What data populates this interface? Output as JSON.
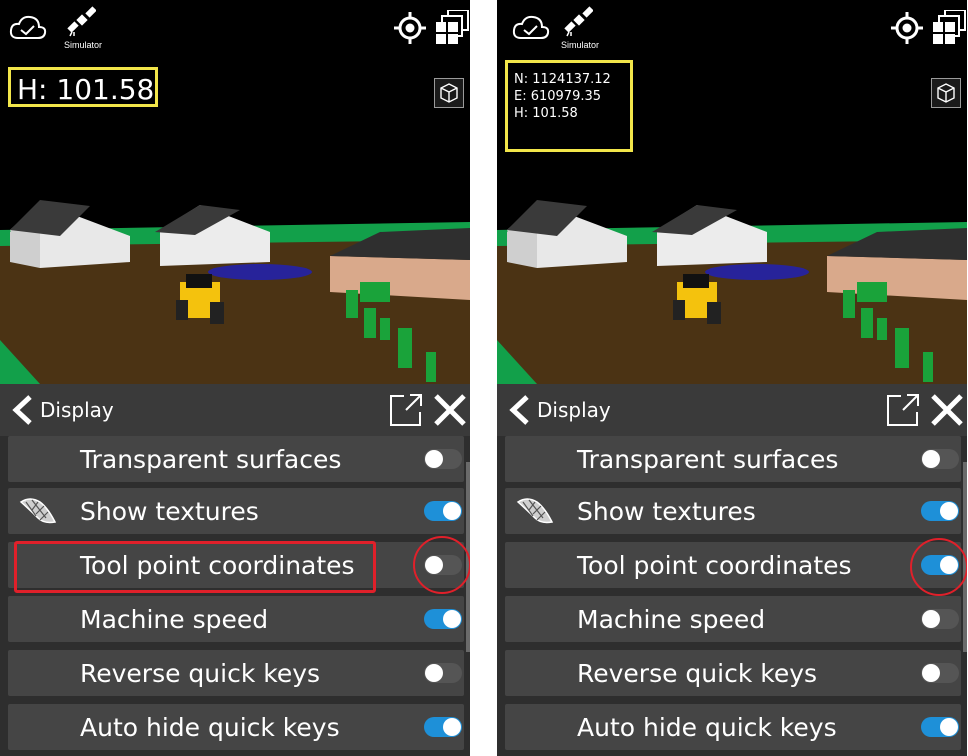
{
  "panels": [
    {
      "id": "before",
      "status": {
        "sim_label": "Simulator"
      },
      "hud": {
        "lines": [
          "H: 101.58"
        ]
      },
      "display": {
        "title": "Display",
        "items": [
          {
            "label": "Transparent surfaces",
            "on": false
          },
          {
            "label": "Show textures",
            "on": true,
            "has_icon": true
          },
          {
            "label": "Tool point coordinates",
            "on": false
          },
          {
            "label": "Machine speed",
            "on": true
          },
          {
            "label": "Reverse quick keys",
            "on": false
          },
          {
            "label": "Auto hide quick keys",
            "on": true
          }
        ]
      }
    },
    {
      "id": "after",
      "status": {
        "sim_label": "Simulator"
      },
      "hud": {
        "lines": [
          "N: 1124137.12",
          "E: 610979.35",
          "H: 101.58"
        ]
      },
      "display": {
        "title": "Display",
        "items": [
          {
            "label": "Transparent surfaces",
            "on": false
          },
          {
            "label": "Show textures",
            "on": true,
            "has_icon": true
          },
          {
            "label": "Tool point coordinates",
            "on": true
          },
          {
            "label": "Machine speed",
            "on": false
          },
          {
            "label": "Reverse quick keys",
            "on": false
          },
          {
            "label": "Auto hide quick keys",
            "on": true
          }
        ]
      }
    }
  ],
  "colors": {
    "toggle_on": "#1e90d8",
    "toggle_off": "#555555",
    "hud_border": "#f2e64a",
    "annotation": "#e0202a"
  }
}
